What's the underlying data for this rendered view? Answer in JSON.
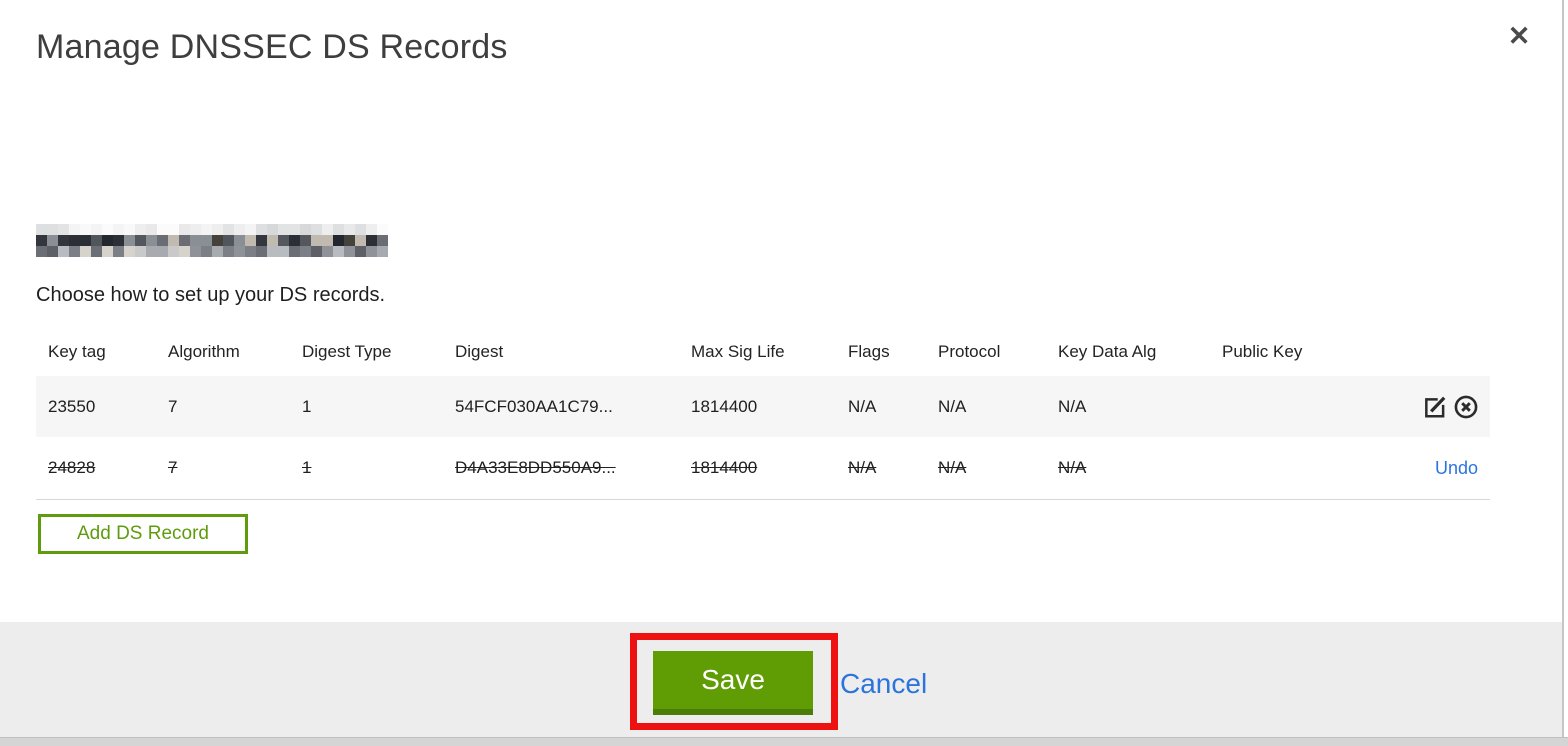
{
  "page": {
    "title": "Manage DNSSEC DS Records",
    "subtitle": "Choose how to set up your DS records.",
    "close_icon": "✕"
  },
  "redacted_domain": {
    "note": "domain name pixelated/redacted in screenshot",
    "rows": 3,
    "cols": 32,
    "palettes": [
      [
        "#f4f4f4",
        "#e9e9ea",
        "#dedfe1",
        "#f9f9f9",
        "#e2e3e5",
        "#eeeeef",
        "#d7d8da",
        "#fbfbfb"
      ],
      [
        "#3a3e45",
        "#24272d",
        "#54575e",
        "#8a8f96",
        "#1f2228",
        "#45423c",
        "#6a6e74",
        "#2c3036",
        "#9aa0a7",
        "#51555c",
        "#33363c",
        "#c0bab0"
      ],
      [
        "#b8bbbf",
        "#8f9399",
        "#6b6f75",
        "#d6d3cd",
        "#5d6167",
        "#a7aaae",
        "#7c8086",
        "#c9c9c9"
      ]
    ]
  },
  "table": {
    "columns": [
      "Key tag",
      "Algorithm",
      "Digest Type",
      "Digest",
      "Max Sig Life",
      "Flags",
      "Protocol",
      "Key Data Alg",
      "Public Key"
    ],
    "rows": [
      {
        "key_tag": "23550",
        "algorithm": "7",
        "digest_type": "1",
        "digest": "54FCF030AA1C79...",
        "max_sig_life": "1814400",
        "flags": "N/A",
        "protocol": "N/A",
        "key_data_alg": "N/A",
        "public_key": "",
        "state": "normal"
      },
      {
        "key_tag": "24828",
        "algorithm": "7",
        "digest_type": "1",
        "digest": "D4A33E8DD550A9...",
        "max_sig_life": "1814400",
        "flags": "N/A",
        "protocol": "N/A",
        "key_data_alg": "N/A",
        "public_key": "",
        "state": "deleted"
      }
    ]
  },
  "actions": {
    "add_ds_record": "Add DS Record",
    "save": "Save",
    "cancel": "Cancel",
    "undo": "Undo"
  },
  "colors": {
    "button_green": "#609d04",
    "button_green_dark": "#4c7d08",
    "outline_green": "#5f9c0d",
    "annotation_red": "#ee1111",
    "link_blue": "#2b74dd",
    "footer_gray": "#ededed",
    "row_shade": "#f6f6f6"
  }
}
